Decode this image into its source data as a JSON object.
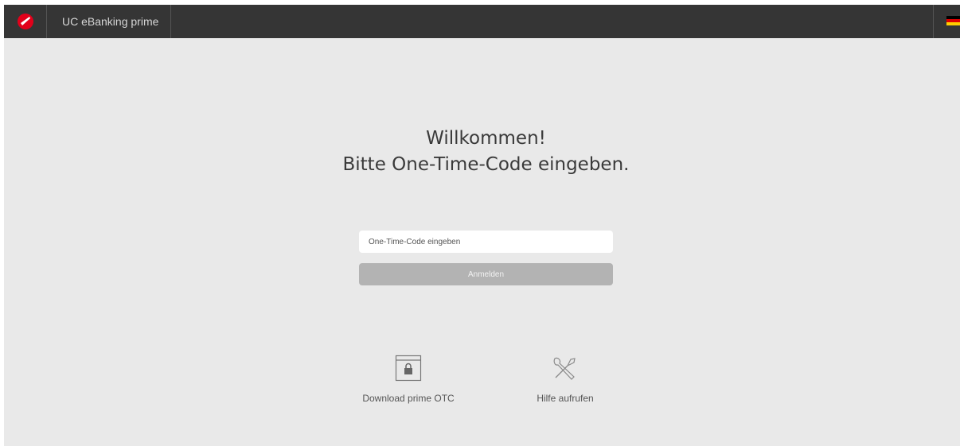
{
  "header": {
    "app_title": "UC eBanking prime",
    "language_flag": "de-flag-icon"
  },
  "main": {
    "welcome_line1": "Willkommen!",
    "welcome_line2": "Bitte One-Time-Code eingeben.",
    "otc_input": {
      "placeholder": "One-Time-Code eingeben",
      "value": ""
    },
    "login_button": "Anmelden"
  },
  "actions": [
    {
      "label": "Download prime OTC",
      "icon": "lock-window-icon"
    },
    {
      "label": "Hilfe aufrufen",
      "icon": "tools-icon"
    }
  ],
  "colors": {
    "header_bg": "#353535",
    "page_bg": "#e9e9e9",
    "button_disabled": "#b3b3b3",
    "brand_red": "#e2001a"
  }
}
